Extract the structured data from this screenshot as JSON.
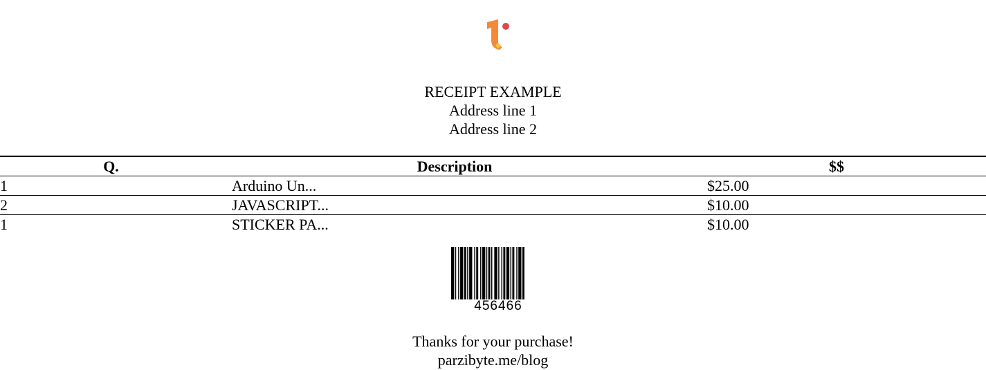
{
  "logo": {
    "icon": "brand-logo-icon",
    "colors": {
      "primary": "#F28A3A",
      "dot": "#E04848",
      "accent": "#F7C23A"
    }
  },
  "header": {
    "title": "RECEIPT EXAMPLE",
    "address_line_1": "Address line 1",
    "address_line_2": "Address line 2"
  },
  "table": {
    "headers": {
      "quantity": "Q.",
      "description": "Description",
      "price": "$$"
    },
    "rows": [
      {
        "quantity": "1",
        "description": "Arduino Un...",
        "price": "$25.00"
      },
      {
        "quantity": "2",
        "description": "JAVASCRIPT...",
        "price": "$10.00"
      },
      {
        "quantity": "1",
        "description": "STICKER PA...",
        "price": "$10.00"
      }
    ]
  },
  "barcode": {
    "value": "456466"
  },
  "footer": {
    "thanks": "Thanks for your purchase!",
    "website": "parzibyte.me/blog"
  }
}
